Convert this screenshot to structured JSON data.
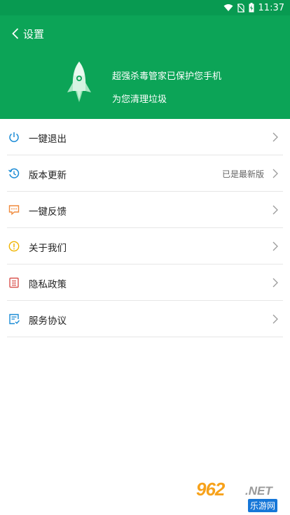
{
  "status_bar": {
    "time": "11:37"
  },
  "header": {
    "title": "设置",
    "promo_line1": "超强杀毒管家已保护您手机",
    "promo_line2": "为您清理垃圾"
  },
  "menu": {
    "items": [
      {
        "label": "一键退出",
        "icon": "power-icon",
        "color": "#1a8bd6"
      },
      {
        "label": "版本更新",
        "value": "已是最新版",
        "icon": "history-clock-icon",
        "color": "#1a8bd6"
      },
      {
        "label": "一键反馈",
        "icon": "feedback-chat-icon",
        "color": "#f08a3c"
      },
      {
        "label": "关于我们",
        "icon": "info-icon",
        "color": "#f0b400"
      },
      {
        "label": "隐私政策",
        "icon": "privacy-list-icon",
        "color": "#d9534f"
      },
      {
        "label": "服务协议",
        "icon": "service-doc-icon",
        "color": "#1a8bd6"
      }
    ]
  },
  "watermark": {
    "brand": "962",
    "net": ".NET",
    "site": "乐游网"
  },
  "colors": {
    "header": "#0ca457",
    "status_bar": "#089a51"
  }
}
